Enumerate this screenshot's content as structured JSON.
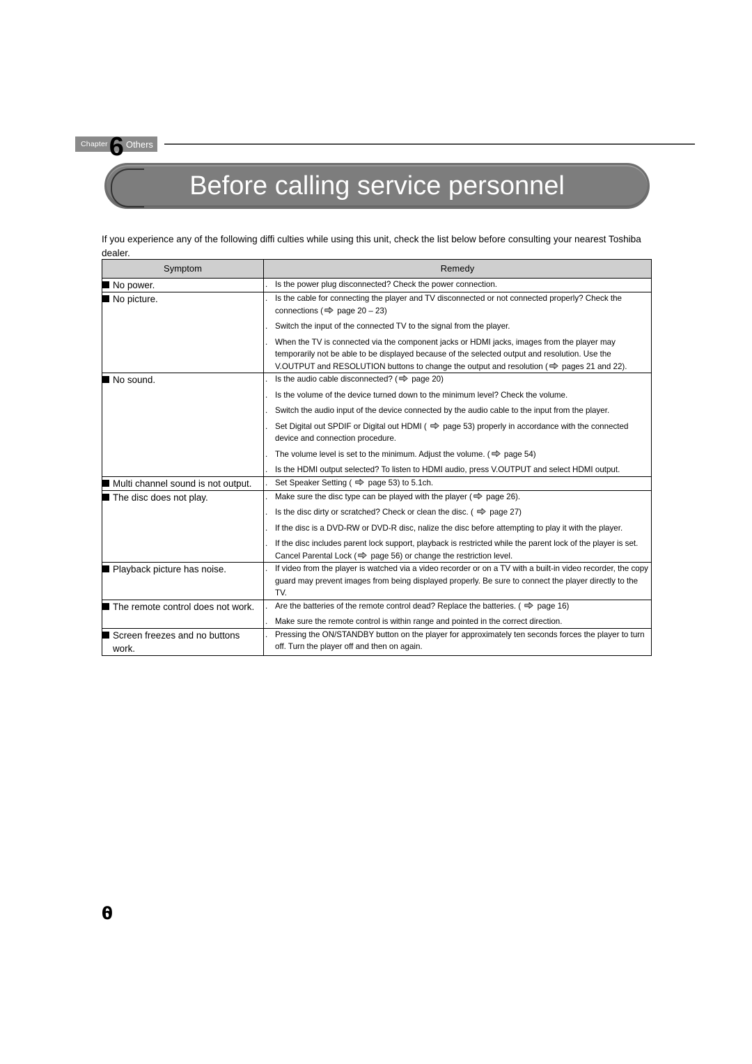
{
  "header": {
    "chapter_word": "Chapter",
    "chapter_number": "6",
    "chapter_name": "Others"
  },
  "title": "Before calling service personnel",
  "intro": "If you experience any of the following diffi culties while using this unit, check the list below before consulting your nearest Toshiba dealer.",
  "table": {
    "columns": [
      "Symptom",
      "Remedy"
    ],
    "rows": [
      {
        "symptom": "No power.",
        "remedies": [
          "Is the power plug disconnected? Check the power connection."
        ]
      },
      {
        "symptom": "No picture.",
        "remedies": [
          "Is the cable for connecting the player and TV disconnected or not connected properly? Check the connections (⇨ page 20 – 23)",
          "Switch the input of the connected TV to the signal from the player.",
          "When the TV is connected via the component jacks or HDMI jacks, images from the player may temporarily not be able to be displayed because of the selected output and resolution. Use the V.OUTPUT and RESOLUTION buttons to change the output and resolution (⇨ pages 21 and 22)."
        ]
      },
      {
        "symptom": "No sound.",
        "remedies": [
          "Is the audio cable disconnected? (⇨ page 20)",
          "Is the volume of the device turned down to the minimum level? Check the volume.",
          "Switch the audio input of the device connected by the audio cable to the input from the player.",
          "Set Digital out SPDIF or Digital out HDMI ( ⇨ page 53) properly in accordance with the connected device and connection procedure.",
          "The volume level is set to the minimum. Adjust the volume. (⇨ page 54)",
          "Is the HDMI output selected? To listen to HDMI audio, press V.OUTPUT and select HDMI output."
        ]
      },
      {
        "symptom": "Multi channel sound is not output.",
        "remedies": [
          "Set Speaker Setting ( ⇨ page 53) to 5.1ch."
        ]
      },
      {
        "symptom": "The disc does not play.",
        "remedies": [
          "Make sure the disc type can be played with the player (⇨ page 26).",
          "Is the disc dirty or scratched? Check or clean the disc. ( ⇨ page 27)",
          "If the disc is a DVD-RW or DVD-R disc, nalize the disc before attempting to play it with the player.",
          "If the disc includes parent lock support, playback is restricted while the parent lock of the player is set. Cancel Parental Lock (⇨ page 56) or change the restriction level."
        ]
      },
      {
        "symptom": "Playback picture has noise.",
        "remedies": [
          "If video from the player is watched via a video recorder or on a TV with a built-in video recorder, the copy guard may prevent images from being displayed properly. Be sure to connect the player directly to the TV."
        ]
      },
      {
        "symptom": "The remote control does not work.",
        "remedies": [
          "Are the batteries of the remote control dead? Replace the batteries. ( ⇨ page 16)",
          "Make sure the remote control is within range and pointed in the correct direction."
        ]
      },
      {
        "symptom": "Screen freezes and no buttons work.",
        "remedies": [
          "Pressing the ON/STANDBY button on the player for approximately ten seconds forces the player to turn off. Turn the player off and then on again."
        ]
      }
    ]
  },
  "page_number": "60",
  "colors": {
    "banner_gray": "#7d7d7d",
    "tab_gray": "#8a8a8a",
    "table_header_gray": "#cfcfcf",
    "rule_gray": "#4a4a4a"
  }
}
